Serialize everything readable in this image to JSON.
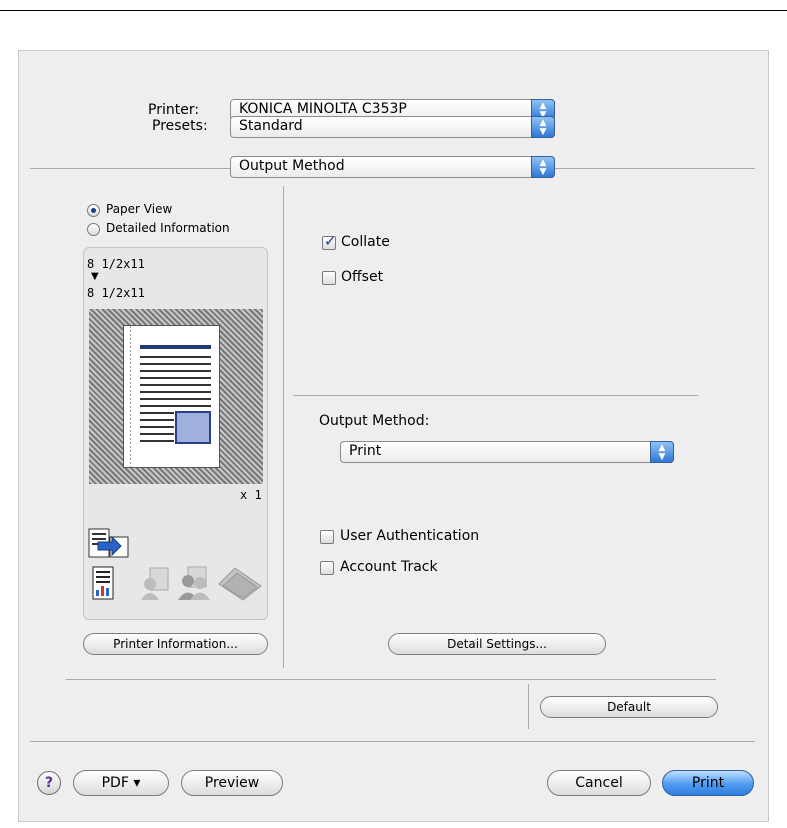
{
  "header": {
    "printer_label": "Printer:",
    "printer_value": "KONICA MINOLTA C353P",
    "presets_label": "Presets:",
    "presets_value": "Standard",
    "panel_value": "Output Method"
  },
  "left": {
    "radio_paper_view": "Paper View",
    "radio_detailed": "Detailed Information",
    "paper_from": "8 1/2x11",
    "arrow": "▼",
    "paper_to": "8 1/2x11",
    "copies": "x 1",
    "printer_info_button": "Printer Information..."
  },
  "right": {
    "collate_label": "Collate",
    "collate_checked": true,
    "offset_label": "Offset",
    "offset_checked": false,
    "output_method_label": "Output Method:",
    "output_method_value": "Print",
    "user_auth_label": "User Authentication",
    "account_track_label": "Account Track",
    "detail_settings_button": "Detail Settings...",
    "default_button": "Default"
  },
  "footer": {
    "help_label": "?",
    "pdf_button": "PDF ▾",
    "preview_button": "Preview",
    "cancel_button": "Cancel",
    "print_button": "Print"
  },
  "colors": {
    "accent": "#2f7fe0",
    "selection_blue": "#1a3f8f"
  }
}
